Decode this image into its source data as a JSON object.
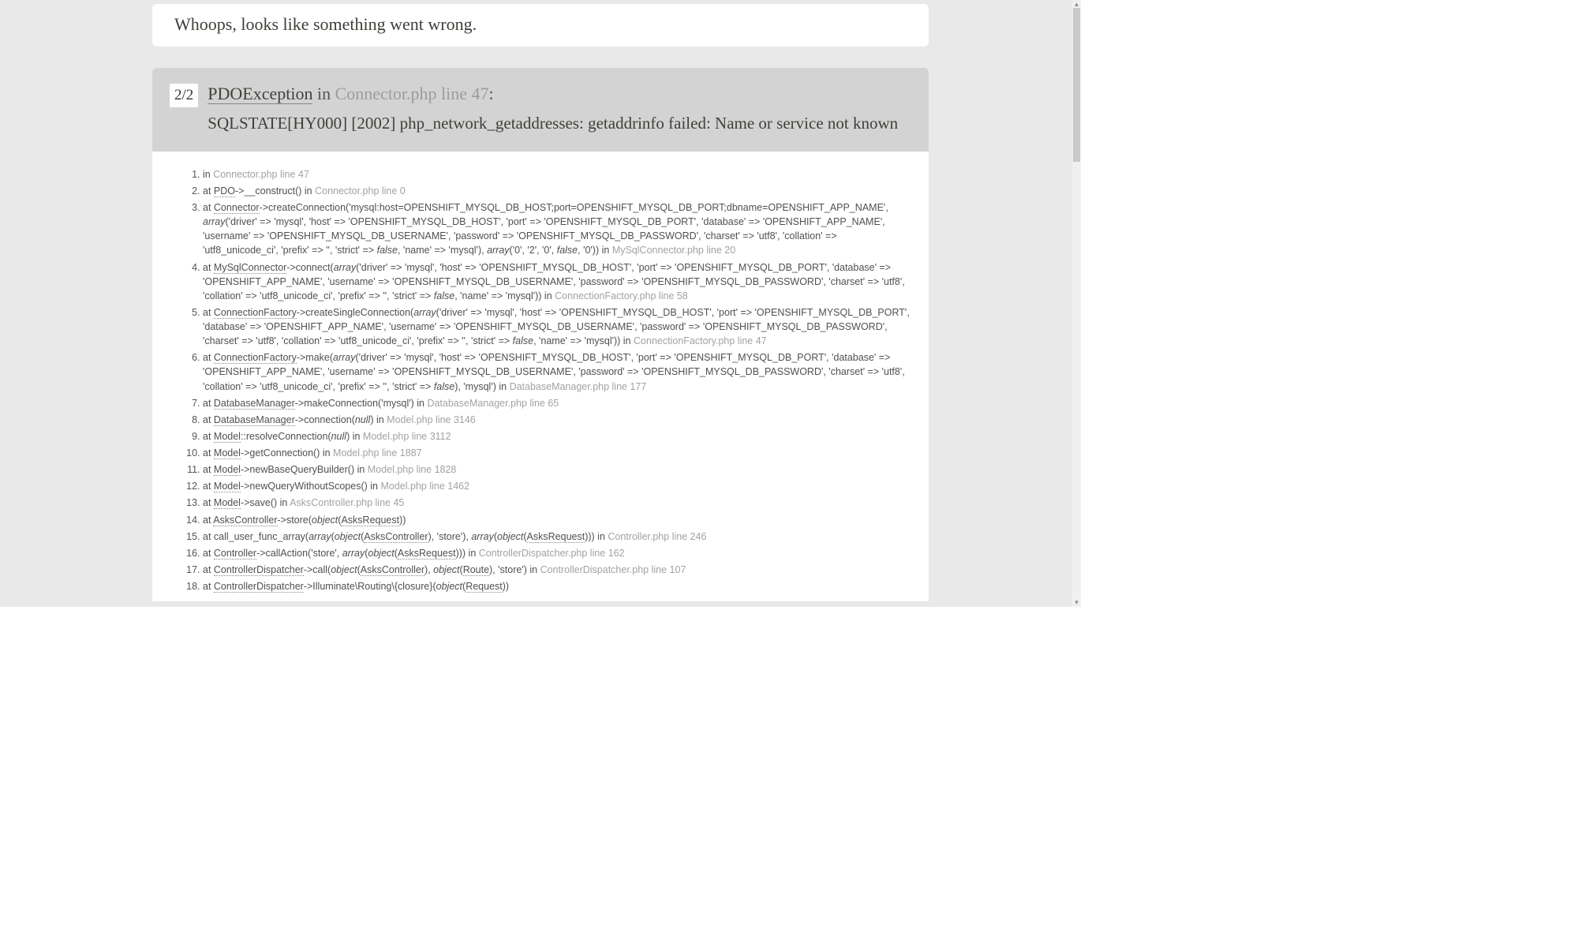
{
  "whoops": "Whoops, looks like something went wrong.",
  "err": {
    "badge": "2/2",
    "exception": "PDOException",
    "in": " in ",
    "location": "Connector.php line 47",
    "colon": ":",
    "message": "SQLSTATE[HY000] [2002] php_network_getaddresses: getaddrinfo failed: Name or service not known"
  },
  "stack": [
    {
      "pre": "in ",
      "loc": "Connector.php line 47"
    },
    {
      "pre": "at ",
      "u": "PDO",
      "post": "->__construct() in ",
      "loc": "Connector.php line 0"
    },
    {
      "pre": "at ",
      "u": "Connector",
      "seg": [
        {
          "t": "->createConnection('mysql:host=OPENSHIFT_MYSQL_DB_HOST;port=OPENSHIFT_MYSQL_DB_PORT;dbname=OPENSHIFT_APP_NAME', "
        },
        {
          "i": "array"
        },
        {
          "t": "('driver' => 'mysql', 'host' => 'OPENSHIFT_MYSQL_DB_HOST', 'port' => 'OPENSHIFT_MYSQL_DB_PORT', 'database' => 'OPENSHIFT_APP_NAME', 'username' => 'OPENSHIFT_MYSQL_DB_USERNAME', 'password' => 'OPENSHIFT_MYSQL_DB_PASSWORD', 'charset' => 'utf8', 'collation' => 'utf8_unicode_ci', 'prefix' => '', 'strict' => "
        },
        {
          "i": "false"
        },
        {
          "t": ", 'name' => 'mysql'), "
        },
        {
          "i": "array"
        },
        {
          "t": "('0', '2', '0', "
        },
        {
          "i": "false"
        },
        {
          "t": ", '0')) in "
        }
      ],
      "loc": "MySqlConnector.php line 20"
    },
    {
      "pre": "at ",
      "u": "MySqlConnector",
      "seg": [
        {
          "t": "->connect("
        },
        {
          "i": "array"
        },
        {
          "t": "('driver' => 'mysql', 'host' => 'OPENSHIFT_MYSQL_DB_HOST', 'port' => 'OPENSHIFT_MYSQL_DB_PORT', 'database' => 'OPENSHIFT_APP_NAME', 'username' => 'OPENSHIFT_MYSQL_DB_USERNAME', 'password' => 'OPENSHIFT_MYSQL_DB_PASSWORD', 'charset' => 'utf8', 'collation' => 'utf8_unicode_ci', 'prefix' => '', 'strict' => "
        },
        {
          "i": "false"
        },
        {
          "t": ", 'name' => 'mysql')) in "
        }
      ],
      "loc": "ConnectionFactory.php line 58"
    },
    {
      "pre": "at ",
      "u": "ConnectionFactory",
      "seg": [
        {
          "t": "->createSingleConnection("
        },
        {
          "i": "array"
        },
        {
          "t": "('driver' => 'mysql', 'host' => 'OPENSHIFT_MYSQL_DB_HOST', 'port' => 'OPENSHIFT_MYSQL_DB_PORT', 'database' => 'OPENSHIFT_APP_NAME', 'username' => 'OPENSHIFT_MYSQL_DB_USERNAME', 'password' => 'OPENSHIFT_MYSQL_DB_PASSWORD', 'charset' => 'utf8', 'collation' => 'utf8_unicode_ci', 'prefix' => '', 'strict' => "
        },
        {
          "i": "false"
        },
        {
          "t": ", 'name' => 'mysql')) in "
        }
      ],
      "loc": "ConnectionFactory.php line 47"
    },
    {
      "pre": "at ",
      "u": "ConnectionFactory",
      "seg": [
        {
          "t": "->make("
        },
        {
          "i": "array"
        },
        {
          "t": "('driver' => 'mysql', 'host' => 'OPENSHIFT_MYSQL_DB_HOST', 'port' => 'OPENSHIFT_MYSQL_DB_PORT', 'database' => 'OPENSHIFT_APP_NAME', 'username' => 'OPENSHIFT_MYSQL_DB_USERNAME', 'password' => 'OPENSHIFT_MYSQL_DB_PASSWORD', 'charset' => 'utf8', 'collation' => 'utf8_unicode_ci', 'prefix' => '', 'strict' => "
        },
        {
          "i": "false"
        },
        {
          "t": "), 'mysql') in "
        }
      ],
      "loc": "DatabaseManager.php line 177"
    },
    {
      "pre": "at ",
      "u": "DatabaseManager",
      "post": "->makeConnection('mysql') in ",
      "loc": "DatabaseManager.php line 65"
    },
    {
      "pre": "at ",
      "u": "DatabaseManager",
      "seg": [
        {
          "t": "->connection("
        },
        {
          "i": "null"
        },
        {
          "t": ") in "
        }
      ],
      "loc": "Model.php line 3146"
    },
    {
      "pre": "at ",
      "u": "Model",
      "seg": [
        {
          "t": "::resolveConnection("
        },
        {
          "i": "null"
        },
        {
          "t": ") in "
        }
      ],
      "loc": "Model.php line 3112"
    },
    {
      "pre": "at ",
      "u": "Model",
      "post": "->getConnection() in ",
      "loc": "Model.php line 1887"
    },
    {
      "pre": "at ",
      "u": "Model",
      "post": "->newBaseQueryBuilder() in ",
      "loc": "Model.php line 1828"
    },
    {
      "pre": "at ",
      "u": "Model",
      "post": "->newQueryWithoutScopes() in ",
      "loc": "Model.php line 1462"
    },
    {
      "pre": "at ",
      "u": "Model",
      "post": "->save() in ",
      "loc": "AsksController.php line 45"
    },
    {
      "pre": "at ",
      "u": "AsksController",
      "seg": [
        {
          "t": "->store("
        },
        {
          "i": "object"
        },
        {
          "t": "("
        },
        {
          "u": "AsksRequest"
        },
        {
          "t": "))"
        }
      ]
    },
    {
      "pre": "at call_user_func_array(",
      "seg": [
        {
          "i": "array"
        },
        {
          "t": "("
        },
        {
          "i": "object"
        },
        {
          "t": "("
        },
        {
          "u": "AsksController"
        },
        {
          "t": "), 'store'), "
        },
        {
          "i": "array"
        },
        {
          "t": "("
        },
        {
          "i": "object"
        },
        {
          "t": "("
        },
        {
          "u": "AsksRequest"
        },
        {
          "t": "))) in "
        }
      ],
      "loc": "Controller.php line 246"
    },
    {
      "pre": "at ",
      "u": "Controller",
      "seg": [
        {
          "t": "->callAction('store', "
        },
        {
          "i": "array"
        },
        {
          "t": "("
        },
        {
          "i": "object"
        },
        {
          "t": "("
        },
        {
          "u": "AsksRequest"
        },
        {
          "t": "))) in "
        }
      ],
      "loc": "ControllerDispatcher.php line 162"
    },
    {
      "pre": "at ",
      "u": "ControllerDispatcher",
      "seg": [
        {
          "t": "->call("
        },
        {
          "i": "object"
        },
        {
          "t": "("
        },
        {
          "u": "AsksController"
        },
        {
          "t": "), "
        },
        {
          "i": "object"
        },
        {
          "t": "("
        },
        {
          "u": "Route"
        },
        {
          "t": "), 'store') in "
        }
      ],
      "loc": "ControllerDispatcher.php line 107"
    },
    {
      "pre": "at ",
      "u": "ControllerDispatcher",
      "seg": [
        {
          "t": "->Illuminate\\Routing\\{closure}("
        },
        {
          "i": "object"
        },
        {
          "t": "("
        },
        {
          "u": "Request"
        },
        {
          "t": "))"
        }
      ]
    }
  ]
}
